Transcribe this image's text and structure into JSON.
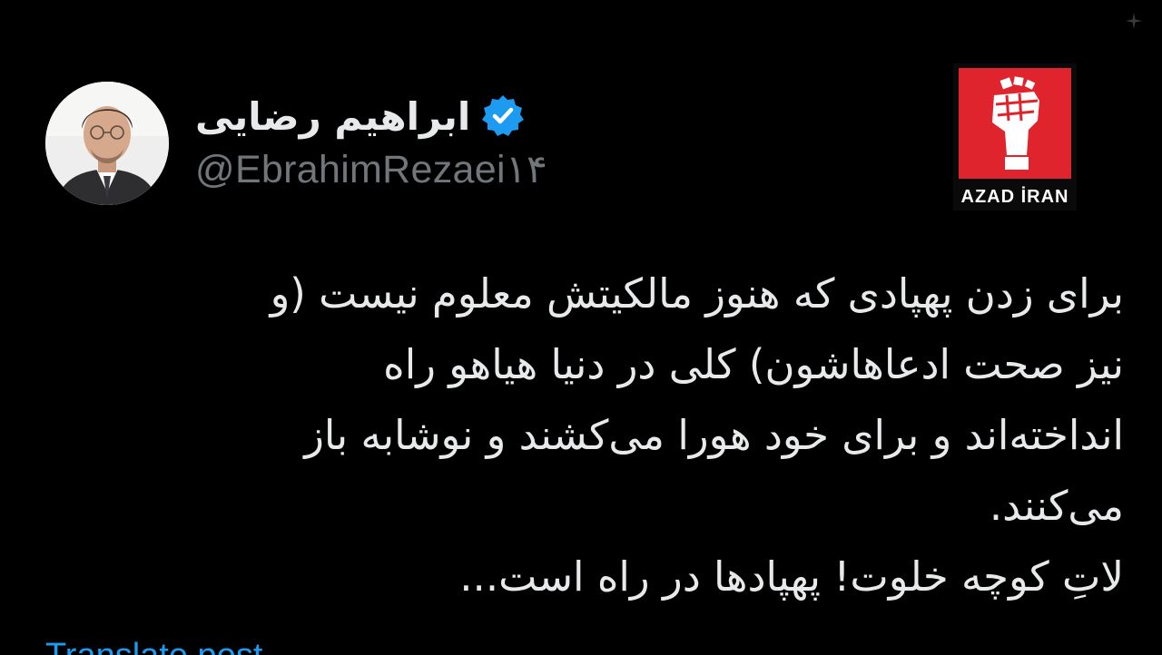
{
  "author": {
    "display_name": "ابراهیم رضایی",
    "handle": "@EbrahimRezaei۱۴",
    "verified_icon": "verified-badge-icon"
  },
  "watermark": {
    "brand_name": "AZAD İRAN",
    "icon": "raised-fist-icon",
    "color": "#e0242d"
  },
  "tweet": {
    "lines": [
      "برای زدن پهپادی که هنوز مالکیتش معلوم نیست (و",
      "نیز صحت ادعاهاشون) کلی در دنیا هیاهو راه",
      "انداخته‌اند و برای خود هورا می‌کشند و نوشابه باز",
      "می‌کنند.",
      "لاتِ کوچه خلوت! پهپادها در راه است..."
    ]
  },
  "footer": {
    "translate_label": "Translate post"
  },
  "colors": {
    "background": "#000000",
    "text": "#e7e9ea",
    "muted": "#71767b",
    "accent": "#1d9bf0"
  }
}
